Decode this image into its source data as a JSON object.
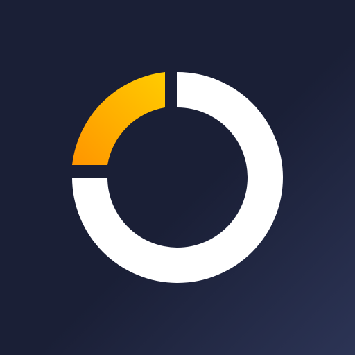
{
  "icon": {
    "name": "donut-progress-logo-icon",
    "background_colors": [
      "#1a1f36",
      "#2c3455"
    ],
    "ring_color": "#ffffff",
    "accent_gradient": [
      "#ff9500",
      "#ffcc00"
    ],
    "accent_fraction": 0.25
  }
}
